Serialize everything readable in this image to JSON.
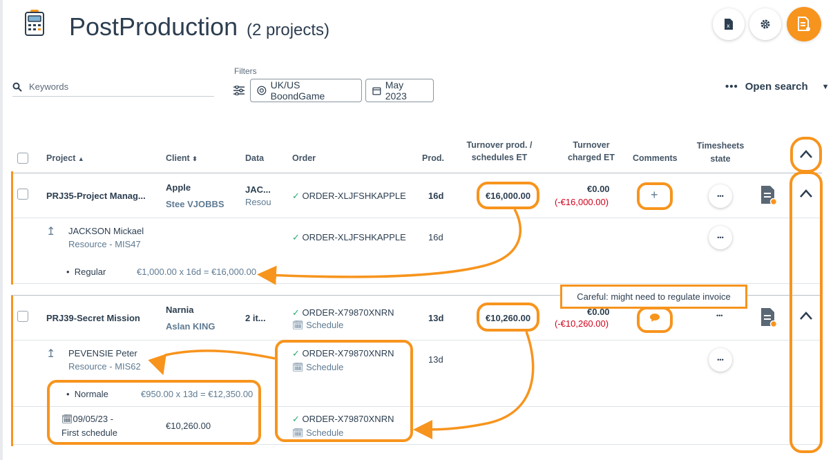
{
  "header": {
    "title": "PostProduction",
    "count": "(2 projects)"
  },
  "filters": {
    "search_placeholder": "Keywords",
    "label": "Filters",
    "chips": [
      "UK/US BoondGame",
      "May 2023"
    ],
    "open_search": "Open search"
  },
  "table": {
    "columns": {
      "project": "Project",
      "client": "Client",
      "data": "Data",
      "order": "Order",
      "prod": "Prod.",
      "turnover_prod_1": "Turnover prod. /",
      "turnover_prod_2": "schedules ET",
      "turnover_charged_1": "Turnover",
      "turnover_charged_2": "charged ET",
      "comments": "Comments",
      "timesheets_1": "Timesheets",
      "timesheets_2": "state"
    },
    "rows": [
      {
        "project": "PRJ35-Project Manag...",
        "client": "Apple",
        "client_contact": "Stee VJOBBS",
        "data": "JAC...",
        "data_sub": "Resou",
        "order": "ORDER-XLJFSHKAPPLE",
        "prod": "16d",
        "turnover_prod": "€16,000.00",
        "charged": "€0.00",
        "charged_diff": "(-€16,000.00)",
        "comment": "+",
        "resource": {
          "name": "JACKSON Mickael",
          "sub": "Resource - MIS47",
          "order": "ORDER-XLJFSHKAPPLE",
          "prod": "16d"
        },
        "detail": {
          "label": "Regular",
          "calc": "€1,000.00 x 16d = €16,000.00"
        }
      },
      {
        "project": "PRJ39-Secret Mission",
        "client": "Narnia",
        "client_contact": "Aslan KING",
        "data": "2 it...",
        "order": "ORDER-X79870XNRN",
        "order_sub": "Schedule",
        "prod": "13d",
        "turnover_prod": "€10,260.00",
        "charged": "€0.00",
        "charged_diff": "(-€10,260.00)",
        "resource": {
          "name": "PEVENSIE Peter",
          "sub": "Resource - MIS62",
          "order": "ORDER-X79870XNRN",
          "order_sub": "Schedule",
          "prod": "13d"
        },
        "detail": {
          "label": "Normale",
          "calc": "€950.00 x 13d = €12,350.00"
        },
        "schedule": {
          "date": "09/05/23 -",
          "label": "First schedule",
          "amount": "€10,260.00",
          "order": "ORDER-X79870XNRN",
          "order_sub": "Schedule"
        }
      }
    ]
  },
  "tooltip": "Careful: might need to regulate invoice"
}
